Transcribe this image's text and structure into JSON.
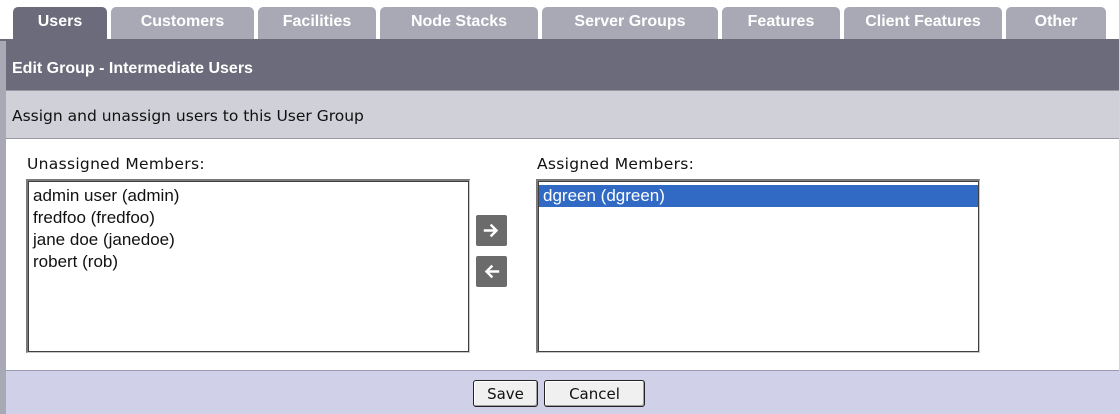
{
  "tabs": [
    {
      "label": "Users",
      "active": true
    },
    {
      "label": "Customers",
      "active": false
    },
    {
      "label": "Facilities",
      "active": false
    },
    {
      "label": "Node Stacks",
      "active": false
    },
    {
      "label": "Server Groups",
      "active": false
    },
    {
      "label": "Features",
      "active": false
    },
    {
      "label": "Client Features",
      "active": false
    },
    {
      "label": "Other",
      "active": false
    }
  ],
  "header": {
    "title": "Edit Group - Intermediate Users",
    "subtitle": "Assign and unassign users to this User Group"
  },
  "unassigned": {
    "label": "Unassigned Members:",
    "items": [
      "admin user (admin)",
      "fredfoo (fredfoo)",
      "jane doe (janedoe)",
      "robert (rob)"
    ]
  },
  "assigned": {
    "label": "Assigned Members:",
    "items": [
      "dgreen (dgreen)"
    ],
    "selected_index": 0
  },
  "controls": {
    "assign_icon": "arrow-right-icon",
    "unassign_icon": "arrow-left-icon"
  },
  "footer": {
    "save_label": "Save",
    "cancel_label": "Cancel"
  },
  "colors": {
    "active_tab": "#6b6b7b",
    "inactive_tab": "#a9a9b6",
    "subtitle_bg": "#d0d0d8",
    "footer_bg": "#d0d0e8",
    "selection": "#316ac5"
  }
}
